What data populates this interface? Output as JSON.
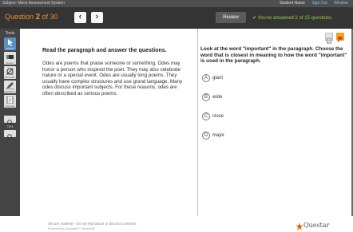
{
  "top_bar": {
    "system_name": "Subject: Mock Assessment System",
    "student_name": "Student Name",
    "sign_out": "Sign Out",
    "window": "Window"
  },
  "question_bar": {
    "question_word": "Question",
    "current": "2",
    "of_label": "of 30",
    "review_label": "Review",
    "answered_text": "You've answered 2 of 15 questions."
  },
  "tools": {
    "title": "Tools",
    "items": [
      {
        "icon": "pointer-icon",
        "label": "Pointer"
      },
      {
        "icon": "eraser-icon",
        "label": "Eraser"
      },
      {
        "icon": "eliminator-icon",
        "label": "Answer Eliminator"
      },
      {
        "icon": "highlighter-icon",
        "label": "Highlighter"
      },
      {
        "icon": "notepad-icon",
        "label": "Notepad"
      }
    ],
    "zoom_level": "75%"
  },
  "passage": {
    "heading": "Read the paragraph and answer the questions.",
    "body": "Odes are poems that praise someone or something. Odes may honor a person who inspired the poet. They may also celebrate nature or a special event. Odes are usually long poems. They usually have complex structures and use grand language. Many odes discuss important subjects. For these reasons, odes are often described as serious poems."
  },
  "question": {
    "stem": "Look at the word \"important\" in the paragraph. Choose the word that is closest in meaning to how the word \"important\" is used in the paragraph.",
    "options": [
      {
        "letter": "A",
        "text": "giant"
      },
      {
        "letter": "B",
        "text": "wide"
      },
      {
        "letter": "C",
        "text": "close"
      },
      {
        "letter": "D",
        "text": "major"
      }
    ]
  },
  "footer": {
    "line1": "Secure material - Do not reproduce or discuss contents.",
    "line2": "Powered by Questar® | Version®",
    "brand": "Questar"
  },
  "colors": {
    "accent_orange": "#f08a2a",
    "answered_green": "#9ccc45",
    "selected_tool_blue": "#5b8fc6"
  }
}
